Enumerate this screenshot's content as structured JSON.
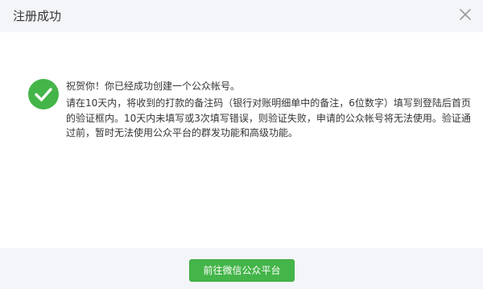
{
  "dialog": {
    "title": "注册成功",
    "close_icon": "close-icon"
  },
  "message": {
    "icon": "success-check-icon",
    "icon_color": "#44b549",
    "title": "祝贺你！你已经成功创建一个公众帐号。",
    "description": "请在10天内，将收到的打款的备注码（银行对账明细单中的备注，6位数字）填写到登陆后首页的验证框内。10天内未填写或3次填写错误，则验证失败，申请的公众帐号将无法使用。验证通过前，暂时无法使用公众平台的群发功能和高级功能。"
  },
  "footer": {
    "primary_button_label": "前往微信公众平台",
    "primary_button_color": "#44b549"
  }
}
